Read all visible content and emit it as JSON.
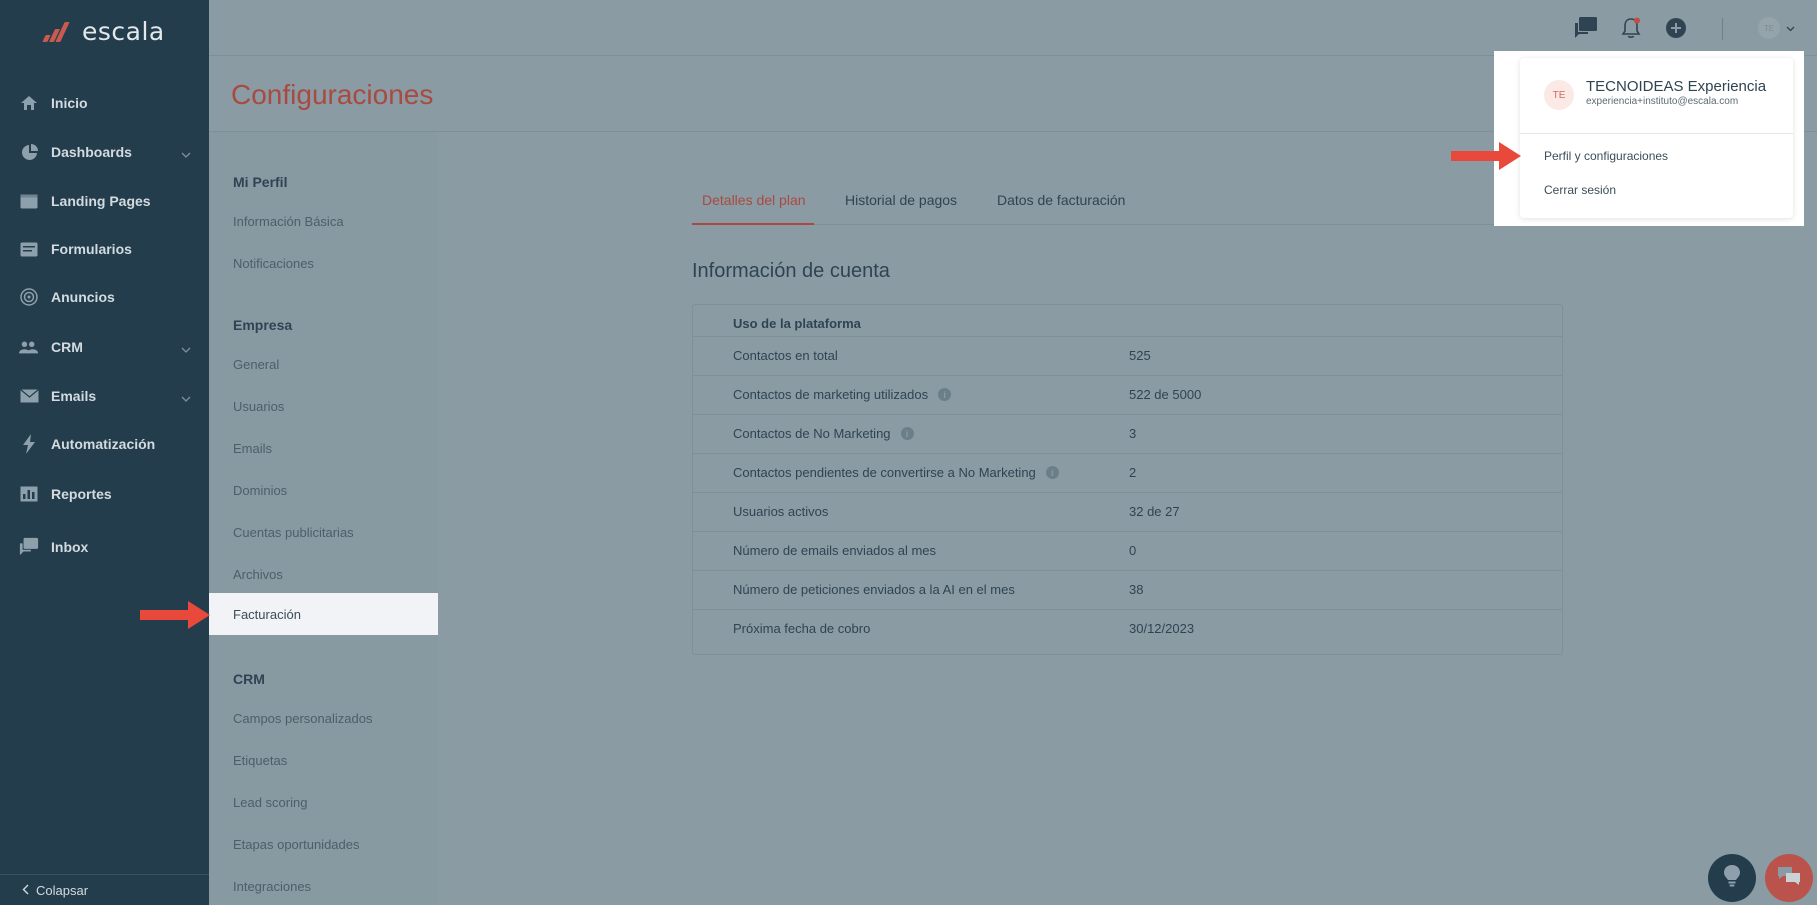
{
  "app": {
    "logo_text": "escala"
  },
  "sidebar": {
    "items": [
      {
        "label": "Inicio",
        "icon": "home-icon"
      },
      {
        "label": "Dashboards",
        "icon": "pie-chart-icon",
        "has_submenu": true
      },
      {
        "label": "Landing Pages",
        "icon": "browser-window-icon"
      },
      {
        "label": "Formularios",
        "icon": "form-icon"
      },
      {
        "label": "Anuncios",
        "icon": "target-icon"
      },
      {
        "label": "CRM",
        "icon": "users-icon",
        "has_submenu": true
      },
      {
        "label": "Emails",
        "icon": "envelope-icon",
        "has_submenu": true
      },
      {
        "label": "Automatización",
        "icon": "lightning-icon"
      },
      {
        "label": "Reportes",
        "icon": "bar-chart-icon"
      },
      {
        "label": "Inbox",
        "icon": "chat-icon"
      }
    ],
    "collapse_label": "Colapsar"
  },
  "topbar": {
    "icons": [
      "inbox-icon",
      "bell-icon",
      "plus-circle-icon"
    ],
    "avatar_initials": "TE"
  },
  "page": {
    "title": "Configuraciones"
  },
  "settings_menu": {
    "sections": [
      {
        "title": "Mi Perfil",
        "items": [
          "Información Básica",
          "Notificaciones"
        ]
      },
      {
        "title": "Empresa",
        "items": [
          "General",
          "Usuarios",
          "Emails",
          "Dominios",
          "Cuentas publicitarias",
          "Archivos",
          "Facturación"
        ]
      },
      {
        "title": "CRM",
        "items": [
          "Campos personalizados",
          "Etiquetas",
          "Lead scoring",
          "Etapas oportunidades",
          "Integraciones"
        ]
      }
    ],
    "active_item": "Facturación"
  },
  "tabs": [
    "Detalles del plan",
    "Historial de pagos",
    "Datos de facturación"
  ],
  "active_tab": "Detalles del plan",
  "account": {
    "section_title": "Información de cuenta",
    "card_title": "Uso de la plataforma",
    "rows": [
      {
        "label": "Contactos en total",
        "value": "525",
        "info": false
      },
      {
        "label": "Contactos de marketing utilizados",
        "value": "522 de 5000",
        "info": true
      },
      {
        "label": "Contactos de No Marketing",
        "value": "3",
        "info": true
      },
      {
        "label": "Contactos pendientes de convertirse a No Marketing",
        "value": "2",
        "info": true
      },
      {
        "label": "Usuarios activos",
        "value": "32 de 27",
        "info": false
      },
      {
        "label": "Número de emails enviados al mes",
        "value": "0",
        "info": false
      },
      {
        "label": "Número de peticiones enviados a la AI en el mes",
        "value": "38",
        "info": false
      },
      {
        "label": "Próxima fecha de cobro",
        "value": "30/12/2023",
        "info": false
      }
    ]
  },
  "user_dropdown": {
    "initials": "TE",
    "name": "TECNOIDEAS Experiencia",
    "email": "experiencia+instituto@escala.com",
    "items": [
      "Perfil y configuraciones",
      "Cerrar sesión"
    ]
  },
  "colors": {
    "sidebar_bg": "#233d4c",
    "accent": "#a94a42",
    "arrow": "#e8493a",
    "overlay": "#8a9ba3"
  },
  "floating_buttons": [
    "lightbulb-icon",
    "chat-bubbles-icon"
  ]
}
